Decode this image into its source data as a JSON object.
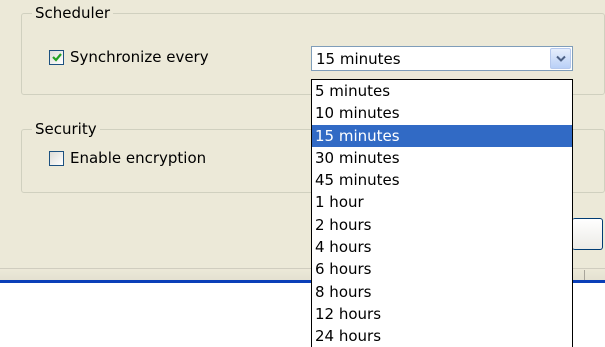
{
  "scheduler": {
    "legend": "Scheduler",
    "sync_label": "Synchronize every",
    "sync_checked": true,
    "interval_selected": "15 minutes",
    "interval_options": [
      "5 minutes",
      "10 minutes",
      "15 minutes",
      "30 minutes",
      "45 minutes",
      "1 hour",
      "2 hours",
      "4 hours",
      "6 hours",
      "8 hours",
      "12 hours",
      "24 hours"
    ]
  },
  "security": {
    "legend": "Security",
    "encrypt_label": "Enable encryption",
    "encrypt_checked": false
  },
  "colors": {
    "selection": "#316ac5",
    "panel": "#ece9d8",
    "checkmark": "#21a121",
    "accent_line": "#0a3fb8"
  },
  "icons": {
    "combo_button": "chevron-down-icon",
    "checkbox_mark": "checkmark-icon"
  }
}
